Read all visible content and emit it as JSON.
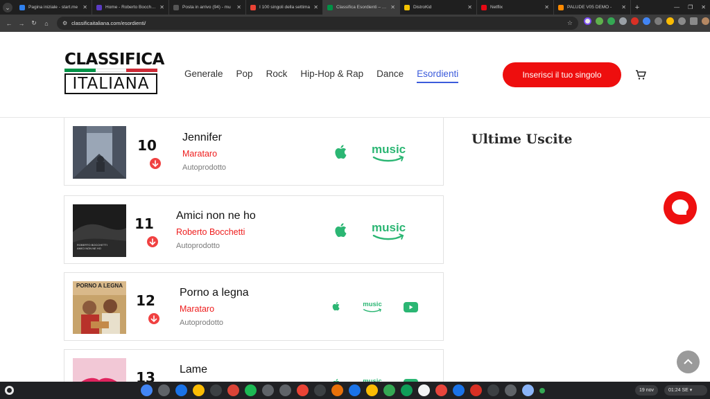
{
  "browser": {
    "tabs": [
      {
        "title": "Pagina iniziale - start.me",
        "favicon_color": "#2f80ed"
      },
      {
        "title": "Home - Roberto Bocchetti",
        "favicon_color": "#5b3cc4"
      },
      {
        "title": "Posta in arrivo (94) - mu",
        "favicon_color": "#555555"
      },
      {
        "title": "I 100 singoli della settima",
        "favicon_color": "#ea4335"
      },
      {
        "title": "Classifica Esordienti – Cla",
        "favicon_color": "#009246",
        "active": true
      },
      {
        "title": "DistroKid",
        "favicon_color": "#f2c200"
      },
      {
        "title": "Netflix",
        "favicon_color": "#e50914"
      },
      {
        "title": "PALUDE V05 DEMO - ",
        "favicon_color": "#ff8a00"
      }
    ],
    "url": "classificaitaliana.com/esordienti/"
  },
  "site": {
    "logo_top": "CLASSIFICA",
    "logo_bottom": "ITALIANA",
    "logo_colors": [
      "#009246",
      "#ffffff",
      "#ce2b37"
    ],
    "nav": [
      {
        "label": "Generale"
      },
      {
        "label": "Pop"
      },
      {
        "label": "Rock"
      },
      {
        "label": "Hip-Hop & Rap"
      },
      {
        "label": "Dance"
      },
      {
        "label": "Esordienti",
        "active": true
      }
    ],
    "cta_label": "Inserisci il tuo singolo",
    "accent": "#ee0e0e",
    "nav_active_color": "#3b5bdb"
  },
  "tracks": [
    {
      "rank": "10",
      "title": "Jennifer",
      "artist": "Marataro",
      "label": "Autoprodotto",
      "trend": "down",
      "services": [
        "apple",
        "amazon"
      ]
    },
    {
      "rank": "11",
      "title": "Amici non ne ho",
      "artist": "Roberto Bocchetti",
      "label": "Autoprodotto",
      "trend": "down",
      "services": [
        "apple",
        "amazon"
      ],
      "cover_text": "ROBERTO BOCCHETTI\nAMICI NON NE HO"
    },
    {
      "rank": "12",
      "title": "Porno a legna",
      "artist": "Marataro",
      "label": "Autoprodotto",
      "trend": "down",
      "services": [
        "apple",
        "amazon",
        "youtube"
      ],
      "cover_text": "PORNO A LEGNA"
    },
    {
      "rank": "13",
      "title": "Lame",
      "artist": "",
      "label": "",
      "trend": "down",
      "services": [
        "apple",
        "amazon",
        "youtube"
      ]
    }
  ],
  "sidebar": {
    "title": "Ultime Uscite"
  },
  "services": {
    "music_text": "music",
    "service_color": "#2bb673"
  },
  "os": {
    "date": "19 nov",
    "time": "01:24 SE"
  }
}
